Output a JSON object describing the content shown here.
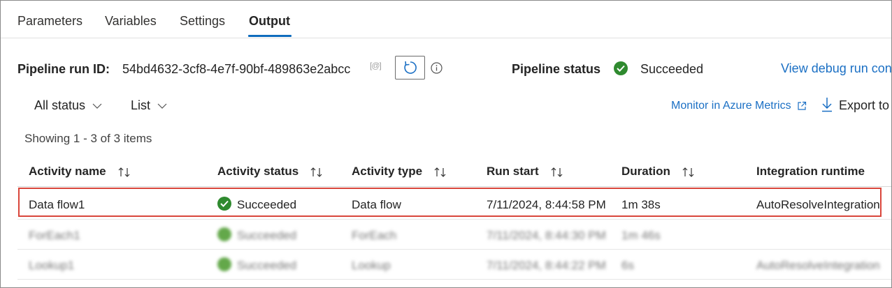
{
  "tabs": [
    {
      "label": "Parameters",
      "active": false
    },
    {
      "label": "Variables",
      "active": false
    },
    {
      "label": "Settings",
      "active": false
    },
    {
      "label": "Output",
      "active": true
    }
  ],
  "run": {
    "id_label": "Pipeline run ID:",
    "id_value": "54bd4632-3cf8-4e7f-90bf-489863e2abcc",
    "copy_icon": "[@]",
    "status_label": "Pipeline status",
    "status_value": "Succeeded",
    "debug_link": "View debug run con"
  },
  "filters": {
    "status": "All status",
    "view": "List"
  },
  "actions": {
    "monitor_link": "Monitor in Azure Metrics",
    "export_label": "Export to"
  },
  "summary": "Showing 1 - 3 of 3 items",
  "table": {
    "columns": [
      "Activity name",
      "Activity status",
      "Activity type",
      "Run start",
      "Duration",
      "Integration runtime"
    ],
    "rows": [
      {
        "name": "Data flow1",
        "status": "Succeeded",
        "type": "Data flow",
        "start": "7/11/2024, 8:44:58 PM",
        "duration": "1m 38s",
        "runtime": "AutoResolveIntegration"
      },
      {
        "name": "ForEach1",
        "status": "Succeeded",
        "type": "ForEach",
        "start": "7/11/2024, 8:44:30 PM",
        "duration": "1m 46s",
        "runtime": ""
      },
      {
        "name": "Lookup1",
        "status": "Succeeded",
        "type": "Lookup",
        "start": "7/11/2024, 8:44:22 PM",
        "duration": "6s",
        "runtime": "AutoResolveIntegration"
      }
    ]
  },
  "colors": {
    "accent": "#0f6cbd",
    "link": "#1a6fc4",
    "success": "#2f8a2f",
    "highlight_border": "#d9463b"
  }
}
